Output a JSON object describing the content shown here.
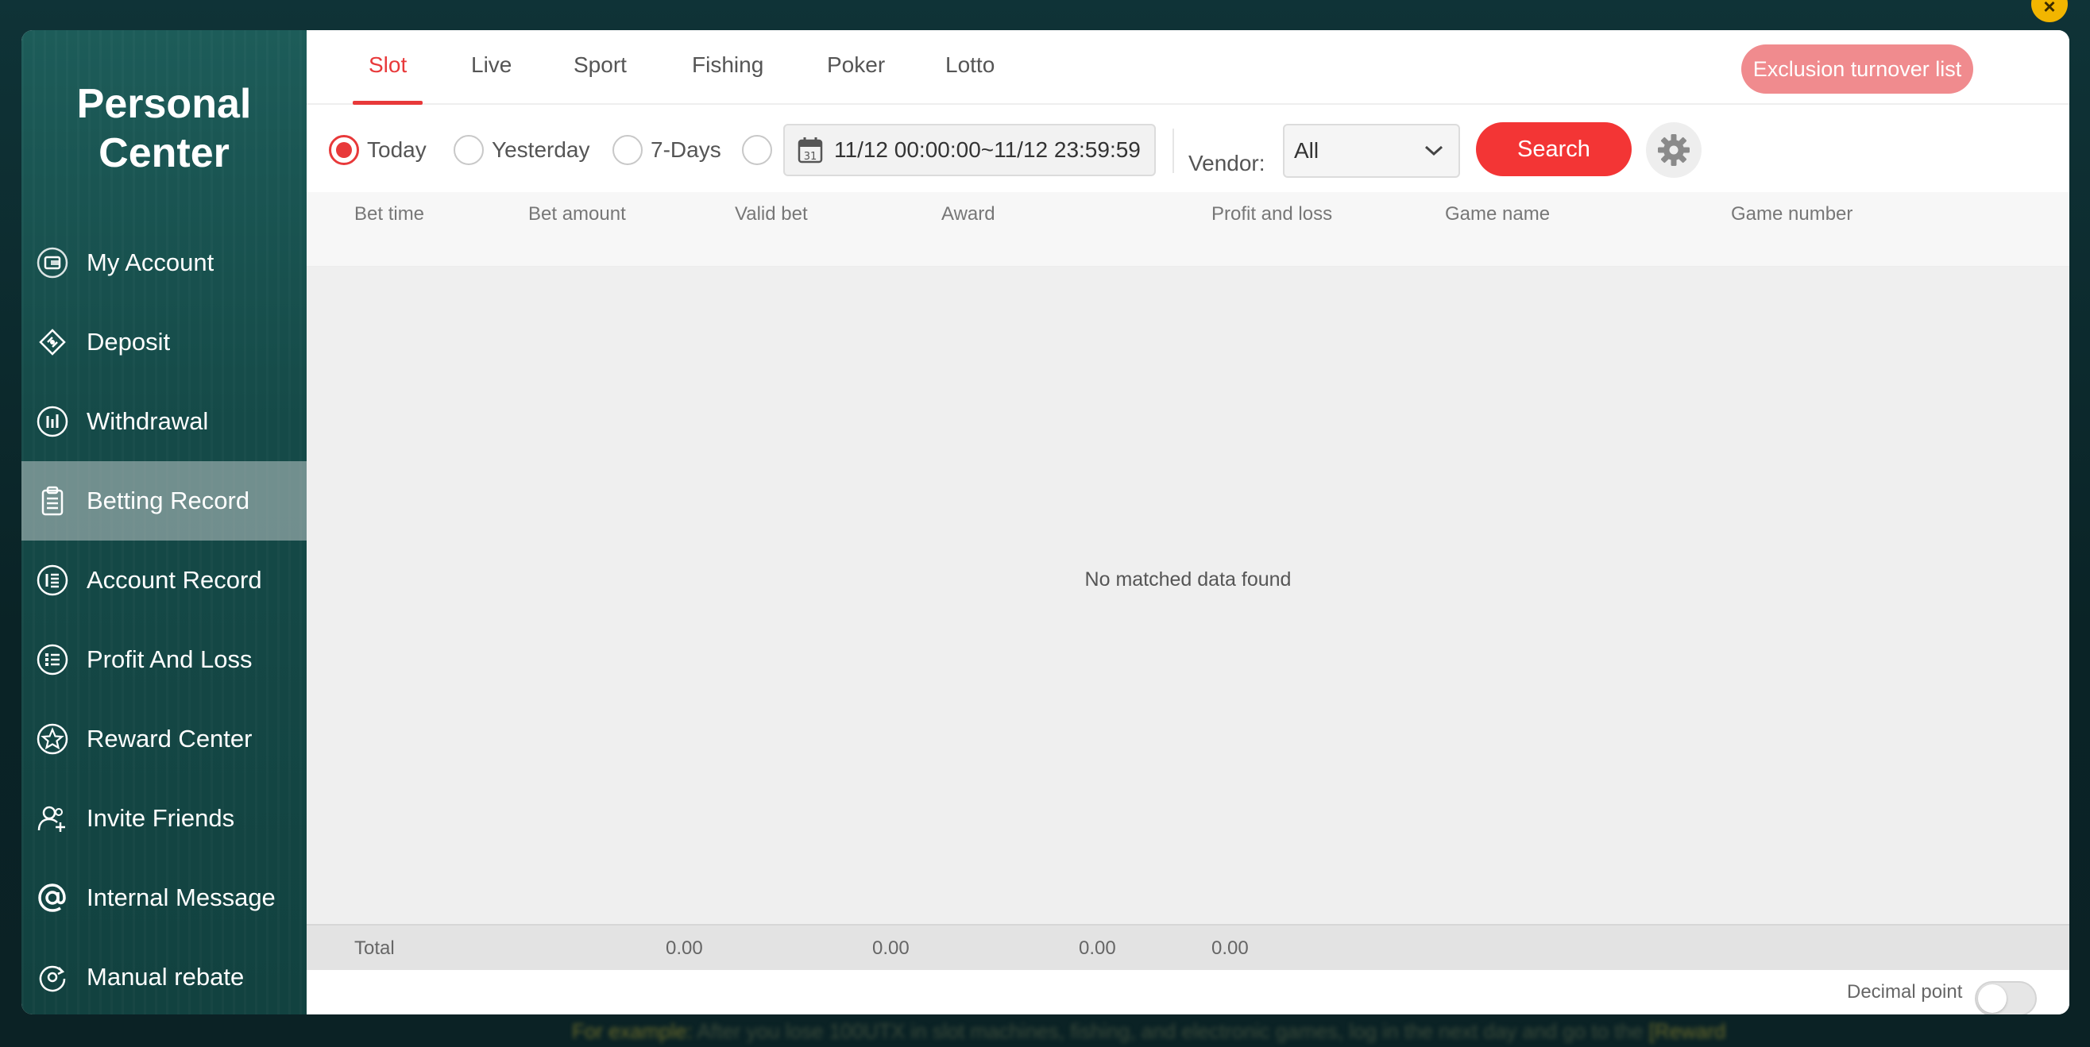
{
  "close_label": "×",
  "sidebar": {
    "title_line1": "Personal",
    "title_line2": "Center",
    "items": [
      {
        "label": "My Account",
        "icon": "wallet-icon"
      },
      {
        "label": "Deposit",
        "icon": "deposit-icon"
      },
      {
        "label": "Withdrawal",
        "icon": "chart-icon"
      },
      {
        "label": "Betting Record",
        "icon": "clipboard-icon",
        "active": true
      },
      {
        "label": "Account Record",
        "icon": "list-icon"
      },
      {
        "label": "Profit And Loss",
        "icon": "ledger-icon"
      },
      {
        "label": "Reward Center",
        "icon": "star-icon"
      },
      {
        "label": "Invite Friends",
        "icon": "add-user-icon"
      },
      {
        "label": "Internal Message",
        "icon": "at-icon"
      },
      {
        "label": "Manual rebate",
        "icon": "rebate-icon"
      }
    ]
  },
  "tabs": [
    {
      "label": "Slot",
      "active": true
    },
    {
      "label": "Live"
    },
    {
      "label": "Sport"
    },
    {
      "label": "Fishing"
    },
    {
      "label": "Poker"
    },
    {
      "label": "Lotto"
    }
  ],
  "exclusion_button": "Exclusion turnover list",
  "filters": {
    "options": [
      "Today",
      "Yesterday",
      "7-Days"
    ],
    "selected": "Today",
    "date_range": "11/12 00:00:00~11/12 23:59:59",
    "vendor_label": "Vendor:",
    "vendor_value": "All",
    "search_label": "Search"
  },
  "table": {
    "columns": [
      "Bet time",
      "Bet amount",
      "Valid bet",
      "Award",
      "Profit and loss",
      "Game name",
      "Game number"
    ],
    "empty_message": "No matched data found",
    "total_label": "Total",
    "totals": [
      "0.00",
      "0.00",
      "0.00",
      "0.00"
    ]
  },
  "footer": {
    "decimal_label": "Decimal point",
    "decimal_on": false
  },
  "background_text": {
    "prefix": "For example:",
    "body": "After you lose 100UTX in slot machines, fishing, and electronic games, log in the next day and go to the",
    "suffix": "[Reward"
  },
  "colors": {
    "accent": "#e8393a",
    "search": "#f33535",
    "exclusion": "#f08b8e",
    "sidebar": "#1d5c59",
    "close": "#f2b500"
  }
}
